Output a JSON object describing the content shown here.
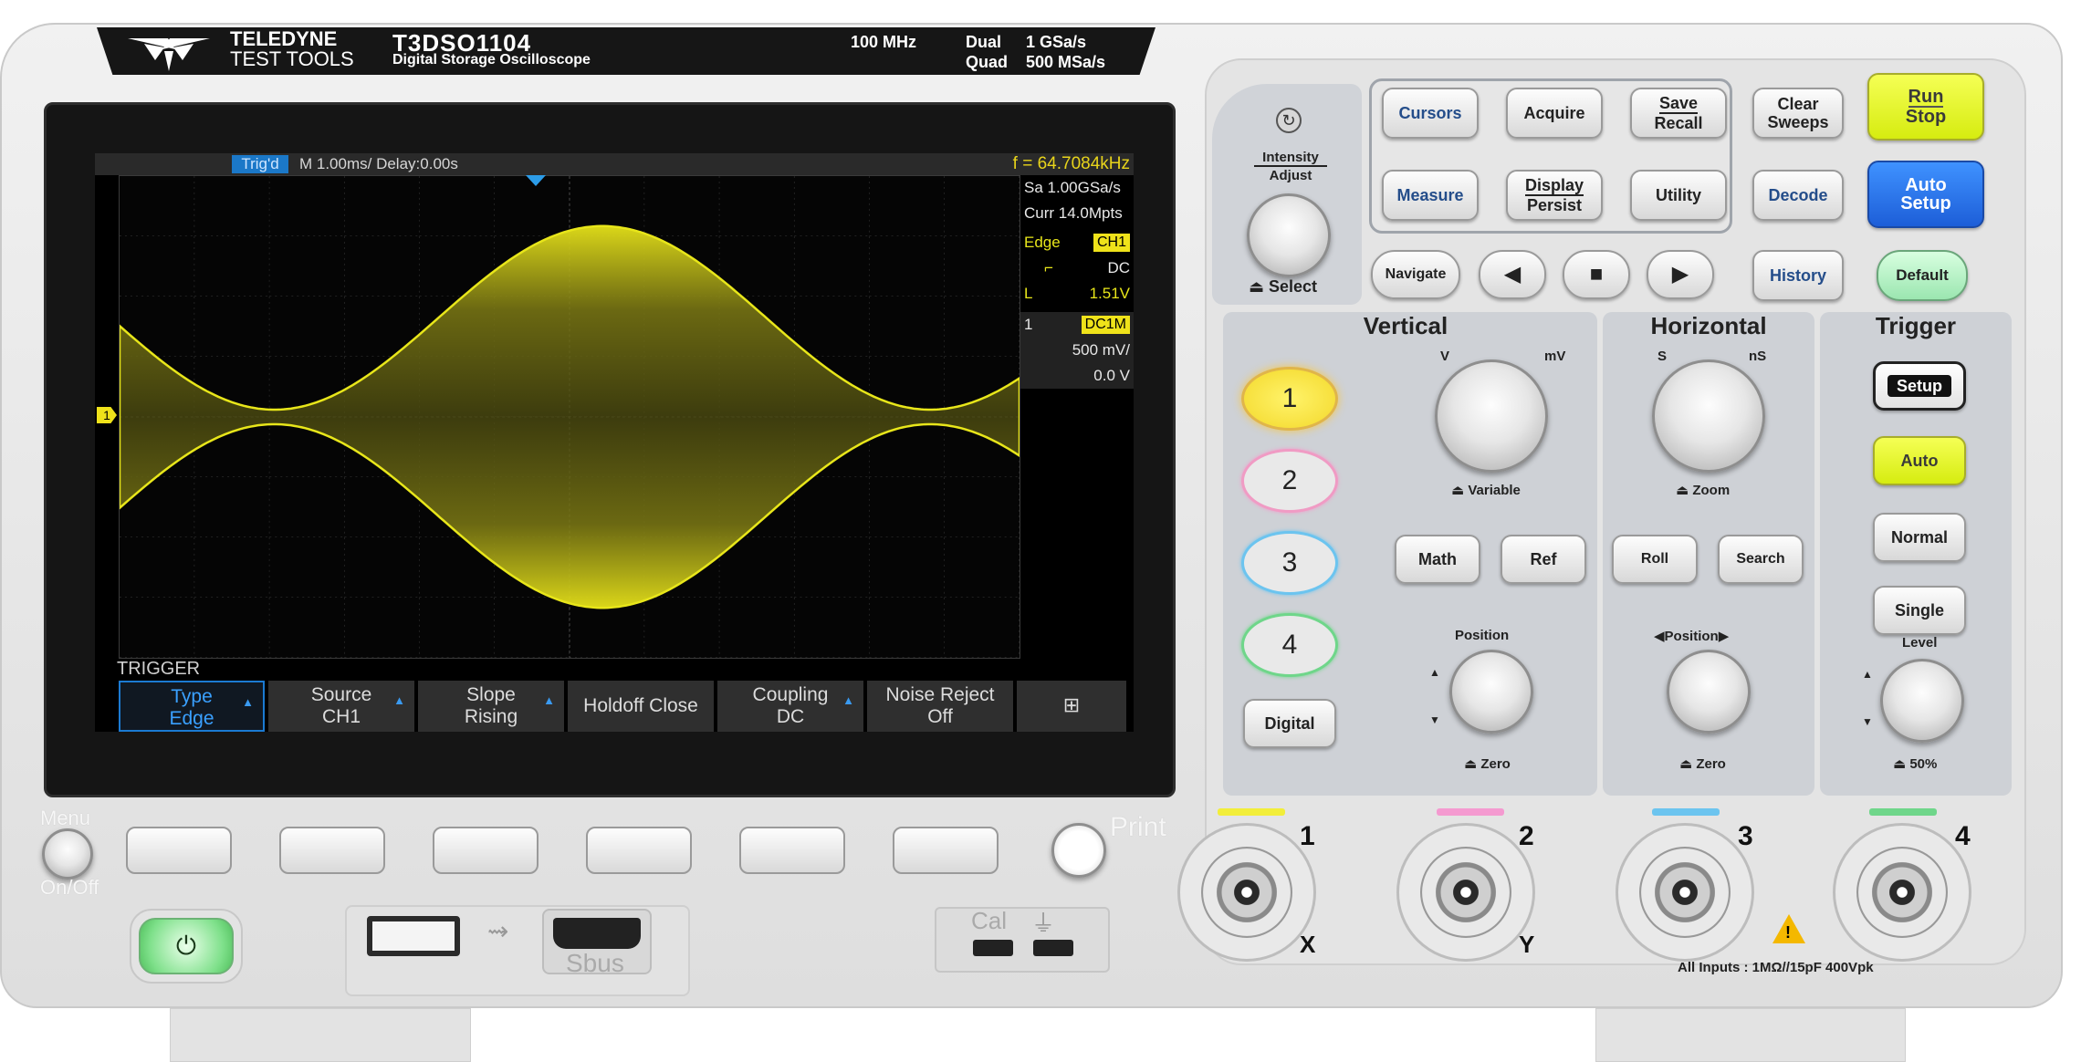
{
  "brand": {
    "line1": "TELEDYNE",
    "line2": "TEST TOOLS"
  },
  "model": {
    "name": "T3DSO1104",
    "desc": "Digital Storage Oscilloscope"
  },
  "spec": {
    "bandwidth": "100 MHz",
    "dual_label": "Dual",
    "dual_rate": "1 GSa/s",
    "quad_label": "Quad",
    "quad_rate": "500 MSa/s"
  },
  "screen": {
    "trig_status": "Trig'd",
    "timebase": "M 1.00ms/ Delay:0.00s",
    "frequency": "f = 64.7084kHz",
    "sample_rate": "Sa 1.00GSa/s",
    "memory": "Curr 14.0Mpts",
    "trigger_type": "Edge",
    "trigger_source": "CH1",
    "trigger_coupling": "DC",
    "trigger_level_label": "L",
    "trigger_level": "1.51V",
    "ch_number": "1",
    "ch_coupling": "DC1M",
    "ch_scale": "500 mV/",
    "ch_offset": "0.0 V",
    "ch_marker": "1",
    "menu_title": "TRIGGER",
    "softkeys": [
      {
        "top": "Type",
        "bottom": "Edge"
      },
      {
        "top": "Source",
        "bottom": "CH1"
      },
      {
        "top": "Slope",
        "bottom": "Rising"
      },
      {
        "top": "Holdoff Close",
        "bottom": ""
      },
      {
        "top": "Coupling",
        "bottom": "DC"
      },
      {
        "top": "Noise Reject",
        "bottom": "Off"
      }
    ],
    "waveform_color": "#e8e61a"
  },
  "front": {
    "menu_label": "Menu",
    "onoff_label": "On/Off",
    "print_label": "Print",
    "sbus_label": "Sbus",
    "cal_label": "Cal",
    "intensity_label": "Intensity",
    "adjust_label": "Adjust",
    "select_label": "Select"
  },
  "buttons": {
    "cursors": "Cursors",
    "acquire": "Acquire",
    "save": "Save",
    "recall": "Recall",
    "clear": "Clear",
    "sweeps": "Sweeps",
    "run": "Run",
    "stop": "Stop",
    "measure": "Measure",
    "display": "Display",
    "persist": "Persist",
    "utility": "Utility",
    "decode": "Decode",
    "auto": "Auto",
    "setup": "Setup",
    "navigate": "Navigate",
    "history": "History",
    "default": "Default"
  },
  "vertical": {
    "title": "Vertical",
    "v": "V",
    "mv": "mV",
    "variable": "Variable",
    "math": "Math",
    "ref": "Ref",
    "position": "Position",
    "zero": "Zero",
    "digital": "Digital",
    "ch1": "1",
    "ch2": "2",
    "ch3": "3",
    "ch4": "4"
  },
  "horizontal": {
    "title": "Horizontal",
    "s": "S",
    "ns": "nS",
    "zoom": "Zoom",
    "roll": "Roll",
    "search": "Search",
    "position": "Position",
    "zero": "Zero"
  },
  "trigger": {
    "title": "Trigger",
    "setup": "Setup",
    "auto": "Auto",
    "normal": "Normal",
    "single": "Single",
    "level": "Level",
    "fifty": "50%"
  },
  "inputs": {
    "ch1": "1",
    "ch2": "2",
    "ch3": "3",
    "ch4": "4",
    "x": "X",
    "y": "Y",
    "note": "All Inputs : 1MΩ//15pF  400Vpk"
  },
  "channel_colors": {
    "ch1": "#f2ee3a",
    "ch2": "#f49ad0",
    "ch3": "#6cc4ef",
    "ch4": "#6fd68a"
  }
}
